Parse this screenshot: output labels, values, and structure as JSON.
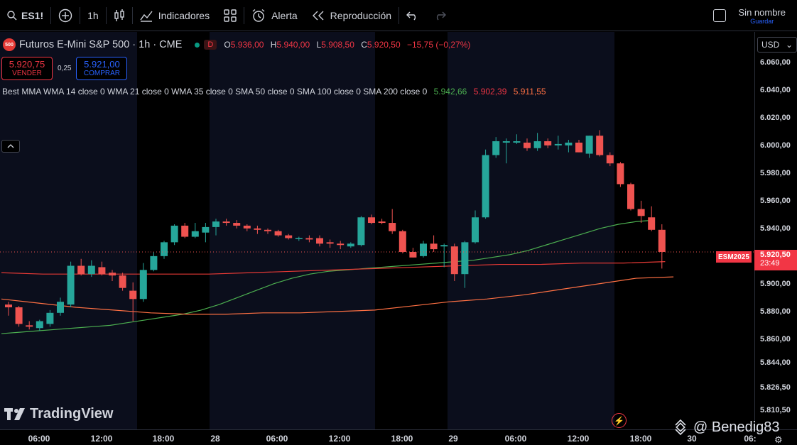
{
  "toolbar": {
    "symbol": "ES1!",
    "interval": "1h",
    "indicators_label": "Indicadores",
    "alert_label": "Alerta",
    "replay_label": "Reproducción",
    "save_name": "Sin nombre",
    "save_sub": "Guardar"
  },
  "legend": {
    "logo_text": "500",
    "title": "Futuros E-Mini S&P 500 · 1h · CME",
    "badge": "D",
    "open_key": "O",
    "open": "5.936,00",
    "high_key": "H",
    "high": "5.940,00",
    "low_key": "L",
    "low": "5.908,50",
    "close_key": "C",
    "close": "5.920,50",
    "change": "−15,75 (−0,27%)",
    "sell_price": "5.920,75",
    "sell_label": "VENDER",
    "spread": "0,25",
    "buy_price": "5.921,00",
    "buy_label": "COMPRAR",
    "indicator_name": "Best MMA WMA 14 close 0 WMA 21 close 0 WMA 35 close 0 SMA 50 close 0 SMA 100 close 0 SMA 200 close 0",
    "ind_val_1": "5.942,66",
    "ind_val_2": "5.902,39",
    "ind_val_3": "5.911,55"
  },
  "price_axis": {
    "currency": "USD",
    "labels": [
      "6.060,00",
      "6.040,00",
      "6.020,00",
      "6.000,00",
      "5.980,00",
      "5.960,00",
      "5.940,00",
      "5.900,00",
      "5.880,00",
      "5.860,00",
      "5.844,00",
      "5.826,50",
      "5.810,50"
    ],
    "last_price": "5.920,50",
    "countdown": "23:49",
    "symbol_tag": "ESM2025"
  },
  "time_axis": {
    "labels": [
      "06:00",
      "12:00",
      "18:00",
      "28",
      "06:00",
      "12:00",
      "18:00",
      "29",
      "06:00",
      "12:00",
      "18:00",
      "30",
      "06:"
    ]
  },
  "branding": {
    "logo_text": "TradingView",
    "credit": "@ Benedig83"
  },
  "colors": {
    "up": "#26a69a",
    "down": "#ef5350",
    "ma_green": "#4caf50",
    "ma_red": "#e53935",
    "ma_orange": "#ff7043",
    "session_bg": "#0b0e1c"
  },
  "chart_data": {
    "type": "candlestick",
    "instrument": "Futuros E-Mini S&P 500",
    "interval": "1h",
    "ylim": [
      5805,
      6066
    ],
    "candles": [
      {
        "o": 5882,
        "h": 5884,
        "l": 5874,
        "c": 5880
      },
      {
        "o": 5880,
        "h": 5881,
        "l": 5866,
        "c": 5868
      },
      {
        "o": 5867,
        "h": 5870,
        "l": 5864,
        "c": 5866
      },
      {
        "o": 5865,
        "h": 5871,
        "l": 5863,
        "c": 5870
      },
      {
        "o": 5868,
        "h": 5878,
        "l": 5866,
        "c": 5876
      },
      {
        "o": 5876,
        "h": 5887,
        "l": 5874,
        "c": 5884
      },
      {
        "o": 5882,
        "h": 5913,
        "l": 5880,
        "c": 5910
      },
      {
        "o": 5910,
        "h": 5915,
        "l": 5903,
        "c": 5904
      },
      {
        "o": 5904,
        "h": 5914,
        "l": 5902,
        "c": 5910
      },
      {
        "o": 5909,
        "h": 5913,
        "l": 5903,
        "c": 5904
      },
      {
        "o": 5905,
        "h": 5907,
        "l": 5899,
        "c": 5903
      },
      {
        "o": 5903,
        "h": 5905,
        "l": 5892,
        "c": 5894
      },
      {
        "o": 5892,
        "h": 5898,
        "l": 5870,
        "c": 5886
      },
      {
        "o": 5886,
        "h": 5912,
        "l": 5884,
        "c": 5907
      },
      {
        "o": 5907,
        "h": 5920,
        "l": 5906,
        "c": 5917
      },
      {
        "o": 5917,
        "h": 5928,
        "l": 5915,
        "c": 5927
      },
      {
        "o": 5927,
        "h": 5940,
        "l": 5925,
        "c": 5939
      },
      {
        "o": 5939,
        "h": 5941,
        "l": 5930,
        "c": 5931
      },
      {
        "o": 5931,
        "h": 5941,
        "l": 5930,
        "c": 5935
      },
      {
        "o": 5934,
        "h": 5941,
        "l": 5927,
        "c": 5938
      },
      {
        "o": 5938,
        "h": 5944,
        "l": 5932,
        "c": 5942
      },
      {
        "o": 5942,
        "h": 5944,
        "l": 5939,
        "c": 5941
      },
      {
        "o": 5941,
        "h": 5943,
        "l": 5937,
        "c": 5939
      },
      {
        "o": 5939,
        "h": 5940,
        "l": 5935,
        "c": 5937
      },
      {
        "o": 5937,
        "h": 5939,
        "l": 5933,
        "c": 5936
      },
      {
        "o": 5936,
        "h": 5937,
        "l": 5933,
        "c": 5935
      },
      {
        "o": 5935,
        "h": 5936,
        "l": 5931,
        "c": 5932
      },
      {
        "o": 5932,
        "h": 5933,
        "l": 5929,
        "c": 5930
      },
      {
        "o": 5930,
        "h": 5931,
        "l": 5928,
        "c": 5930
      },
      {
        "o": 5930,
        "h": 5932,
        "l": 5927,
        "c": 5929
      },
      {
        "o": 5930,
        "h": 5932,
        "l": 5924,
        "c": 5926
      },
      {
        "o": 5927,
        "h": 5929,
        "l": 5923,
        "c": 5926
      },
      {
        "o": 5926,
        "h": 5928,
        "l": 5922,
        "c": 5925
      },
      {
        "o": 5924,
        "h": 5927,
        "l": 5923,
        "c": 5926
      },
      {
        "o": 5925,
        "h": 5946,
        "l": 5924,
        "c": 5945
      },
      {
        "o": 5945,
        "h": 5947,
        "l": 5940,
        "c": 5941
      },
      {
        "o": 5942,
        "h": 5944,
        "l": 5940,
        "c": 5941
      },
      {
        "o": 5941,
        "h": 5951,
        "l": 5933,
        "c": 5935
      },
      {
        "o": 5935,
        "h": 5936,
        "l": 5919,
        "c": 5920
      },
      {
        "o": 5920,
        "h": 5923,
        "l": 5916,
        "c": 5916
      },
      {
        "o": 5917,
        "h": 5928,
        "l": 5916,
        "c": 5926
      },
      {
        "o": 5926,
        "h": 5932,
        "l": 5920,
        "c": 5922
      },
      {
        "o": 5924,
        "h": 5926,
        "l": 5909,
        "c": 5925
      },
      {
        "o": 5924,
        "h": 5926,
        "l": 5899,
        "c": 5904
      },
      {
        "o": 5904,
        "h": 5928,
        "l": 5894,
        "c": 5927
      },
      {
        "o": 5927,
        "h": 5950,
        "l": 5926,
        "c": 5945
      },
      {
        "o": 5945,
        "h": 5994,
        "l": 5944,
        "c": 5990
      },
      {
        "o": 5990,
        "h": 6003,
        "l": 5988,
        "c": 6000
      },
      {
        "o": 5999,
        "h": 6002,
        "l": 5984,
        "c": 6000
      },
      {
        "o": 5999,
        "h": 6005,
        "l": 5998,
        "c": 6000
      },
      {
        "o": 5999,
        "h": 6002,
        "l": 5993,
        "c": 5995
      },
      {
        "o": 5995,
        "h": 6006,
        "l": 5993,
        "c": 6000
      },
      {
        "o": 6000,
        "h": 6002,
        "l": 5995,
        "c": 5997
      },
      {
        "o": 5997,
        "h": 6004,
        "l": 5994,
        "c": 5998
      },
      {
        "o": 5997,
        "h": 6001,
        "l": 5992,
        "c": 5999
      },
      {
        "o": 5999,
        "h": 6001,
        "l": 5992,
        "c": 5992
      },
      {
        "o": 5991,
        "h": 6004,
        "l": 5988,
        "c": 6004
      },
      {
        "o": 6004,
        "h": 6008,
        "l": 5989,
        "c": 5990
      },
      {
        "o": 5990,
        "h": 5992,
        "l": 5982,
        "c": 5984
      },
      {
        "o": 5984,
        "h": 5985,
        "l": 5967,
        "c": 5969
      },
      {
        "o": 5969,
        "h": 5970,
        "l": 5950,
        "c": 5951
      },
      {
        "o": 5951,
        "h": 5957,
        "l": 5941,
        "c": 5946
      },
      {
        "o": 5945,
        "h": 5953,
        "l": 5935,
        "c": 5936
      },
      {
        "o": 5936,
        "h": 5940,
        "l": 5908,
        "c": 5920
      }
    ],
    "ma_green": [
      5861,
      5862,
      5863,
      5864,
      5865,
      5866,
      5867,
      5869,
      5871,
      5873,
      5875,
      5878,
      5882,
      5887,
      5892,
      5897,
      5901,
      5904,
      5906,
      5907,
      5908,
      5909,
      5910,
      5911,
      5912,
      5913,
      5914,
      5916,
      5918,
      5921,
      5925,
      5929,
      5933,
      5937,
      5940,
      5942,
      5943
    ],
    "ma_red": [
      5905,
      5904,
      5904,
      5904,
      5904,
      5904,
      5905,
      5906,
      5907,
      5908,
      5909,
      5910,
      5911,
      5911,
      5912,
      5912,
      5913
    ],
    "ma_orange": [
      5886,
      5883,
      5880,
      5878,
      5876,
      5875,
      5875,
      5876,
      5876,
      5877,
      5878,
      5881,
      5884,
      5886,
      5889,
      5893,
      5897,
      5901,
      5902
    ]
  }
}
